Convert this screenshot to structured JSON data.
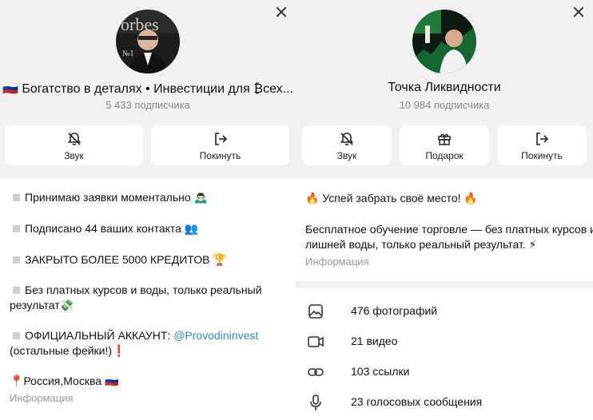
{
  "left": {
    "title": "🇷🇺 Богатство в деталях • Инвестиции для ₿сех...",
    "subscribers": "5 433 подписчика",
    "buttons": [
      {
        "label": "Звук",
        "icon": "bell-off-icon"
      },
      {
        "label": "Покинуть",
        "icon": "leave-icon"
      }
    ],
    "lines": [
      {
        "text": "Принимаю заявки моментально",
        "emoji": "🙇🏻‍♂️"
      },
      {
        "text": "Подписано 44 ваших контакта",
        "emoji": "👥"
      },
      {
        "text": "ЗАКРЫТО БОЛЕЕ 5000 КРЕДИТОВ",
        "emoji": "🏆"
      },
      {
        "text": "Без платных курсов и воды, только реальный",
        "text2": "результат",
        "emoji": "💸"
      },
      {
        "text": "ОФИЦИАЛЬНЫЙ АККАУНТ: ",
        "link": "@Provodininvest",
        "text2": "(остальные фейки!)",
        "emoji": "❗"
      },
      {
        "text": "Россия,Москва",
        "emoji_before": "📍",
        "emoji": "🇷🇺"
      }
    ],
    "info_label": "Информация"
  },
  "right": {
    "title": "Точка Ликвидности",
    "subscribers": "10 984 подписчика",
    "buttons": [
      {
        "label": "Звук",
        "icon": "bell-off-icon"
      },
      {
        "label": "Подарок",
        "icon": "gift-icon"
      },
      {
        "label": "Покинуть",
        "icon": "leave-icon"
      }
    ],
    "desc_heading": "Успей забрать своё место!",
    "fire_emoji": "🔥",
    "desc_line1": "Бесплатное обучение торговле — без платных курсов и",
    "desc_line2": "лишней воды, только реальный результат.",
    "bolt_emoji": "⚡",
    "info_label": "Информация",
    "media": [
      {
        "label": "476 фотографий",
        "icon": "photo-icon"
      },
      {
        "label": "21 видео",
        "icon": "video-icon"
      },
      {
        "label": "103 ссылки",
        "icon": "link-icon"
      },
      {
        "label": "23 голосовых сообщения",
        "icon": "mic-icon"
      }
    ]
  }
}
